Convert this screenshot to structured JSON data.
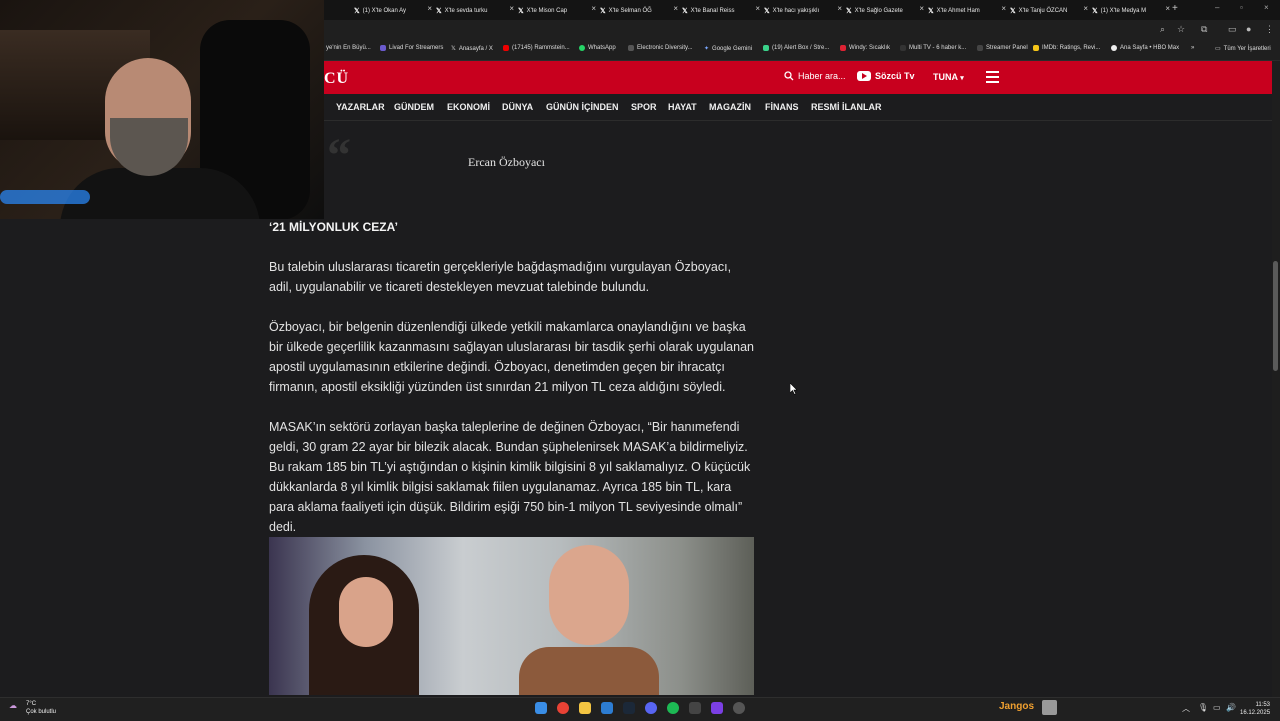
{
  "browser": {
    "tabs": [
      {
        "label": "(1) X'te Okan Ay"
      },
      {
        "label": "X'te sevda turku"
      },
      {
        "label": "X'te Mison Cap"
      },
      {
        "label": "X'te Selman ÖĞ"
      },
      {
        "label": "X'te Banal Reiss"
      },
      {
        "label": "X'te hacı yakışıklı"
      },
      {
        "label": "X'te Sağlo Gazete"
      },
      {
        "label": "X'te Ahmet Ham"
      },
      {
        "label": "X'te Tanju ÖZCAN"
      },
      {
        "label": "(1) X'te Medya M"
      }
    ],
    "new_tab": "+",
    "bookmarks": [
      {
        "label": "ye'nin En Büyü..."
      },
      {
        "label": "Livad For Streamers"
      },
      {
        "label": "Anasayfa / X"
      },
      {
        "label": "(17145) Rammstein..."
      },
      {
        "label": "WhatsApp"
      },
      {
        "label": "Electronic Diversity..."
      },
      {
        "label": "Google Gemini"
      },
      {
        "label": "(19) Alert Box / Stre..."
      },
      {
        "label": "Windy: Sıcaklık"
      },
      {
        "label": "Multi TV - 6 haber k..."
      },
      {
        "label": "Streamer Panel"
      },
      {
        "label": "IMDb: Ratings, Revi..."
      },
      {
        "label": "Ana Sayfa • HBO Max"
      }
    ],
    "bookmarks_more": "»",
    "all_bookmarks": "Tüm Yer İşaretleri"
  },
  "site": {
    "logo": "CÜ",
    "search_label": "Haber ara...",
    "tv_label": "Sözcü Tv",
    "user_label": "TUNA",
    "nav": [
      "YAZARLAR",
      "GÜNDEM",
      "EKONOMİ",
      "DÜNYA",
      "GÜNÜN İÇİNDEN",
      "SPOR",
      "HAYAT",
      "MAGAZİN",
      "FİNANS",
      "RESMİ İLANLAR"
    ]
  },
  "article": {
    "quote_author": "Ercan Özboyacı",
    "heading": "‘21 MİLYONLUK CEZA’",
    "paragraphs": [
      "Bu talebin uluslararası ticaretin gerçekleriyle bağdaşmadığını vurgulayan Özboyacı, adil, uygulanabilir ve ticareti destekleyen mevzuat talebinde bulundu.",
      "Özboyacı, bir belgenin düzenlendiği ülkede yetkili makamlarca onaylandığını ve başka bir ülkede geçerlilik kazanmasını sağlayan uluslararası bir tasdik şerhi olarak uygulanan apostil uygulamasının etkilerine değindi. Özboyacı, denetimden geçen bir ihracatçı firmanın, apostil eksikliği yüzünden üst sınırdan 21 milyon TL ceza aldığını söyledi.",
      "MASAK’ın sektörü zorlayan başka taleplerine de değinen Özboyacı, “Bir hanımefendi geldi, 30 gram 22 ayar bir bilezik alacak. Bundan şüphelenirsek MASAK’a bildirmeliyiz. Bu rakam 185 bin TL’yi aştığından o kişinin kimlik bilgisini 8 yıl saklamalıyız. O küçücük dükkanlarda 8 yıl kimlik bilgisi saklamak fiilen uygulanamaz. Ayrıca 185 bin TL, kara para aklama faaliyeti için düşük. Bildirim eşiği 750 bin-1 milyon TL seviyesinde olmalı” dedi."
    ]
  },
  "taskbar": {
    "weather_temp": "7°C",
    "weather_desc": "Çok bulutlu",
    "streamer_name": "Jangos",
    "time": "11:53",
    "date": "16.12.2025"
  },
  "colors": {
    "brand_red": "#c8001e",
    "page_bg": "#1c1c1e"
  }
}
